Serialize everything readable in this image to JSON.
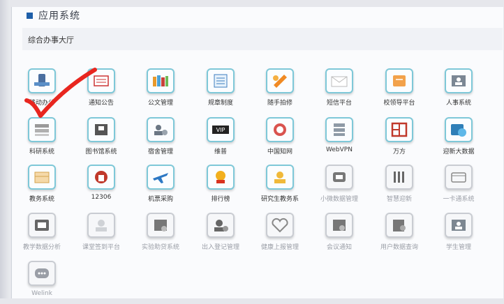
{
  "header": {
    "title": "应用系统",
    "subtitle": "综合办事大厅"
  },
  "apps": [
    {
      "label": "移动办公",
      "icon": "mobile-office-icon",
      "dim": false
    },
    {
      "label": "通知公告",
      "icon": "notice-icon",
      "dim": false
    },
    {
      "label": "公文管理",
      "icon": "document-management-icon",
      "dim": false
    },
    {
      "label": "规章制度",
      "icon": "regulations-icon",
      "dim": false
    },
    {
      "label": "随手拍修",
      "icon": "repair-icon",
      "dim": false
    },
    {
      "label": "短信平台",
      "icon": "sms-icon",
      "dim": false
    },
    {
      "label": "校领导平台",
      "icon": "leader-platform-icon",
      "dim": false
    },
    {
      "label": "人事系统",
      "icon": "hr-system-icon",
      "dim": false
    },
    {
      "label": "科研系统",
      "icon": "research-icon",
      "dim": false
    },
    {
      "label": "图书馆系统",
      "icon": "library-icon",
      "dim": false
    },
    {
      "label": "宿舍管理",
      "icon": "dormitory-icon",
      "dim": false
    },
    {
      "label": "维普",
      "icon": "vip-icon",
      "dim": false
    },
    {
      "label": "中国知网",
      "icon": "cnki-icon",
      "dim": false
    },
    {
      "label": "WebVPN",
      "icon": "webvpn-icon",
      "dim": false
    },
    {
      "label": "万方",
      "icon": "wanfang-icon",
      "dim": false
    },
    {
      "label": "迎新大数据",
      "icon": "big-data-icon",
      "dim": false
    },
    {
      "label": "教务系统",
      "icon": "academic-icon",
      "dim": false
    },
    {
      "label": "12306",
      "icon": "railway-icon",
      "dim": false
    },
    {
      "label": "机票采购",
      "icon": "flight-icon",
      "dim": false
    },
    {
      "label": "排行榜",
      "icon": "ranking-icon",
      "dim": false
    },
    {
      "label": "研究生教务系",
      "icon": "graduate-icon",
      "dim": false
    },
    {
      "label": "小微数据管理",
      "icon": "data-management-icon",
      "dim": true
    },
    {
      "label": "智慧迎新",
      "icon": "smart-welcome-icon",
      "dim": true
    },
    {
      "label": "一卡通系统",
      "icon": "card-system-icon",
      "dim": true
    },
    {
      "label": "教学数据分析",
      "icon": "teaching-analytics-icon",
      "dim": true
    },
    {
      "label": "课堂签到平台",
      "icon": "checkin-icon",
      "dim": true
    },
    {
      "label": "实验助贷系统",
      "icon": "lab-loan-icon",
      "dim": true
    },
    {
      "label": "出入登记管理",
      "icon": "access-register-icon",
      "dim": true
    },
    {
      "label": "健康上报管理",
      "icon": "health-report-icon",
      "dim": true
    },
    {
      "label": "会议通知",
      "icon": "meeting-notice-icon",
      "dim": true
    },
    {
      "label": "用户数据查询",
      "icon": "user-query-icon",
      "dim": true
    },
    {
      "label": "学生管理",
      "icon": "student-management-icon",
      "dim": true
    },
    {
      "label": "Welink",
      "icon": "welink-icon",
      "dim": true
    }
  ],
  "colors": {
    "accent": "#1e5fa9",
    "tile_border": "#7ec8d8",
    "check": "#e8261f"
  }
}
